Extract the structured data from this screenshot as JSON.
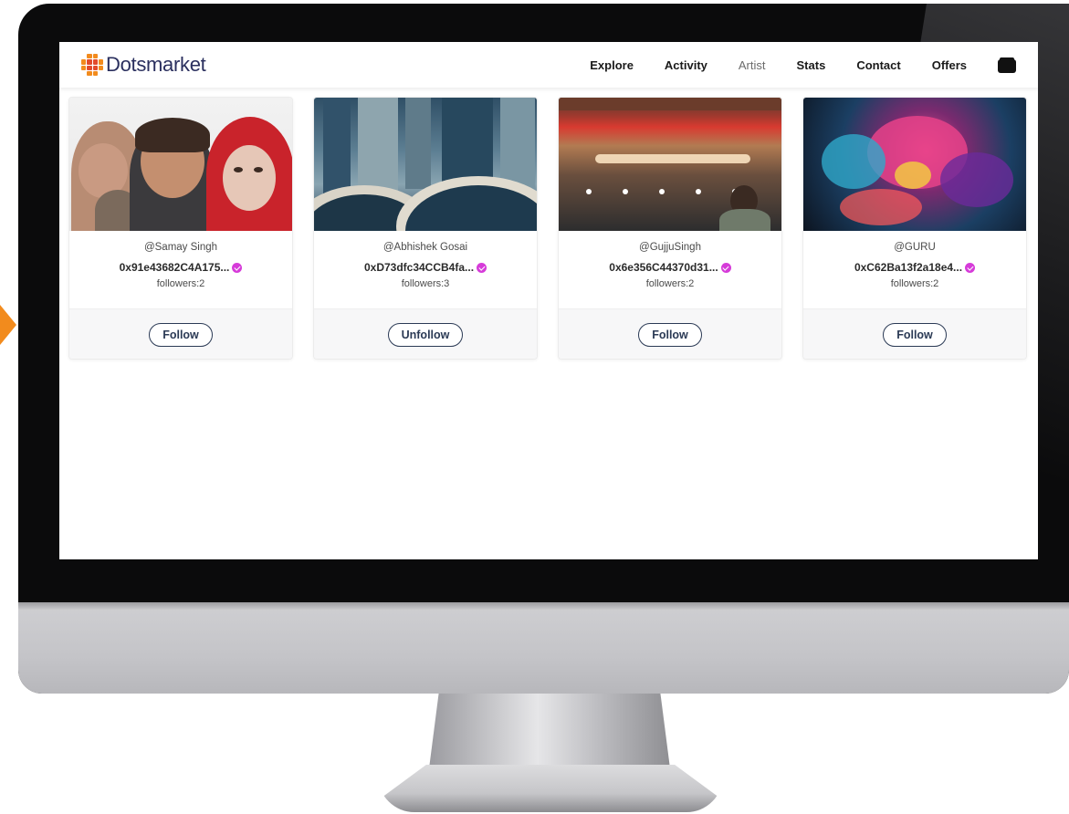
{
  "brand": {
    "name": "Dotsmarket"
  },
  "nav": {
    "items": [
      {
        "label": "Explore"
      },
      {
        "label": "Activity"
      },
      {
        "label": "Artist",
        "active": true
      },
      {
        "label": "Stats"
      },
      {
        "label": "Contact"
      },
      {
        "label": "Offers"
      }
    ],
    "wallet_icon": "wallet-icon"
  },
  "artists": [
    {
      "username": "@Samay Singh",
      "address": "0x91e43682C4A175...",
      "followers": "followers:2",
      "button": "Follow"
    },
    {
      "username": "@Abhishek Gosai",
      "address": "0xD73dfc34CCB4fa...",
      "followers": "followers:3",
      "button": "Unfollow"
    },
    {
      "username": "@GujjuSingh",
      "address": "0x6e356C44370d31...",
      "followers": "followers:2",
      "button": "Follow"
    },
    {
      "username": "@GURU",
      "address": "0xC62Ba13f2a18e4...",
      "followers": "followers:2",
      "button": "Follow"
    }
  ],
  "colors": {
    "verified": "#d63bd9",
    "button_border": "#2b3a55",
    "logo_orange": "#f28b1d",
    "logo_red": "#e24a2c"
  }
}
